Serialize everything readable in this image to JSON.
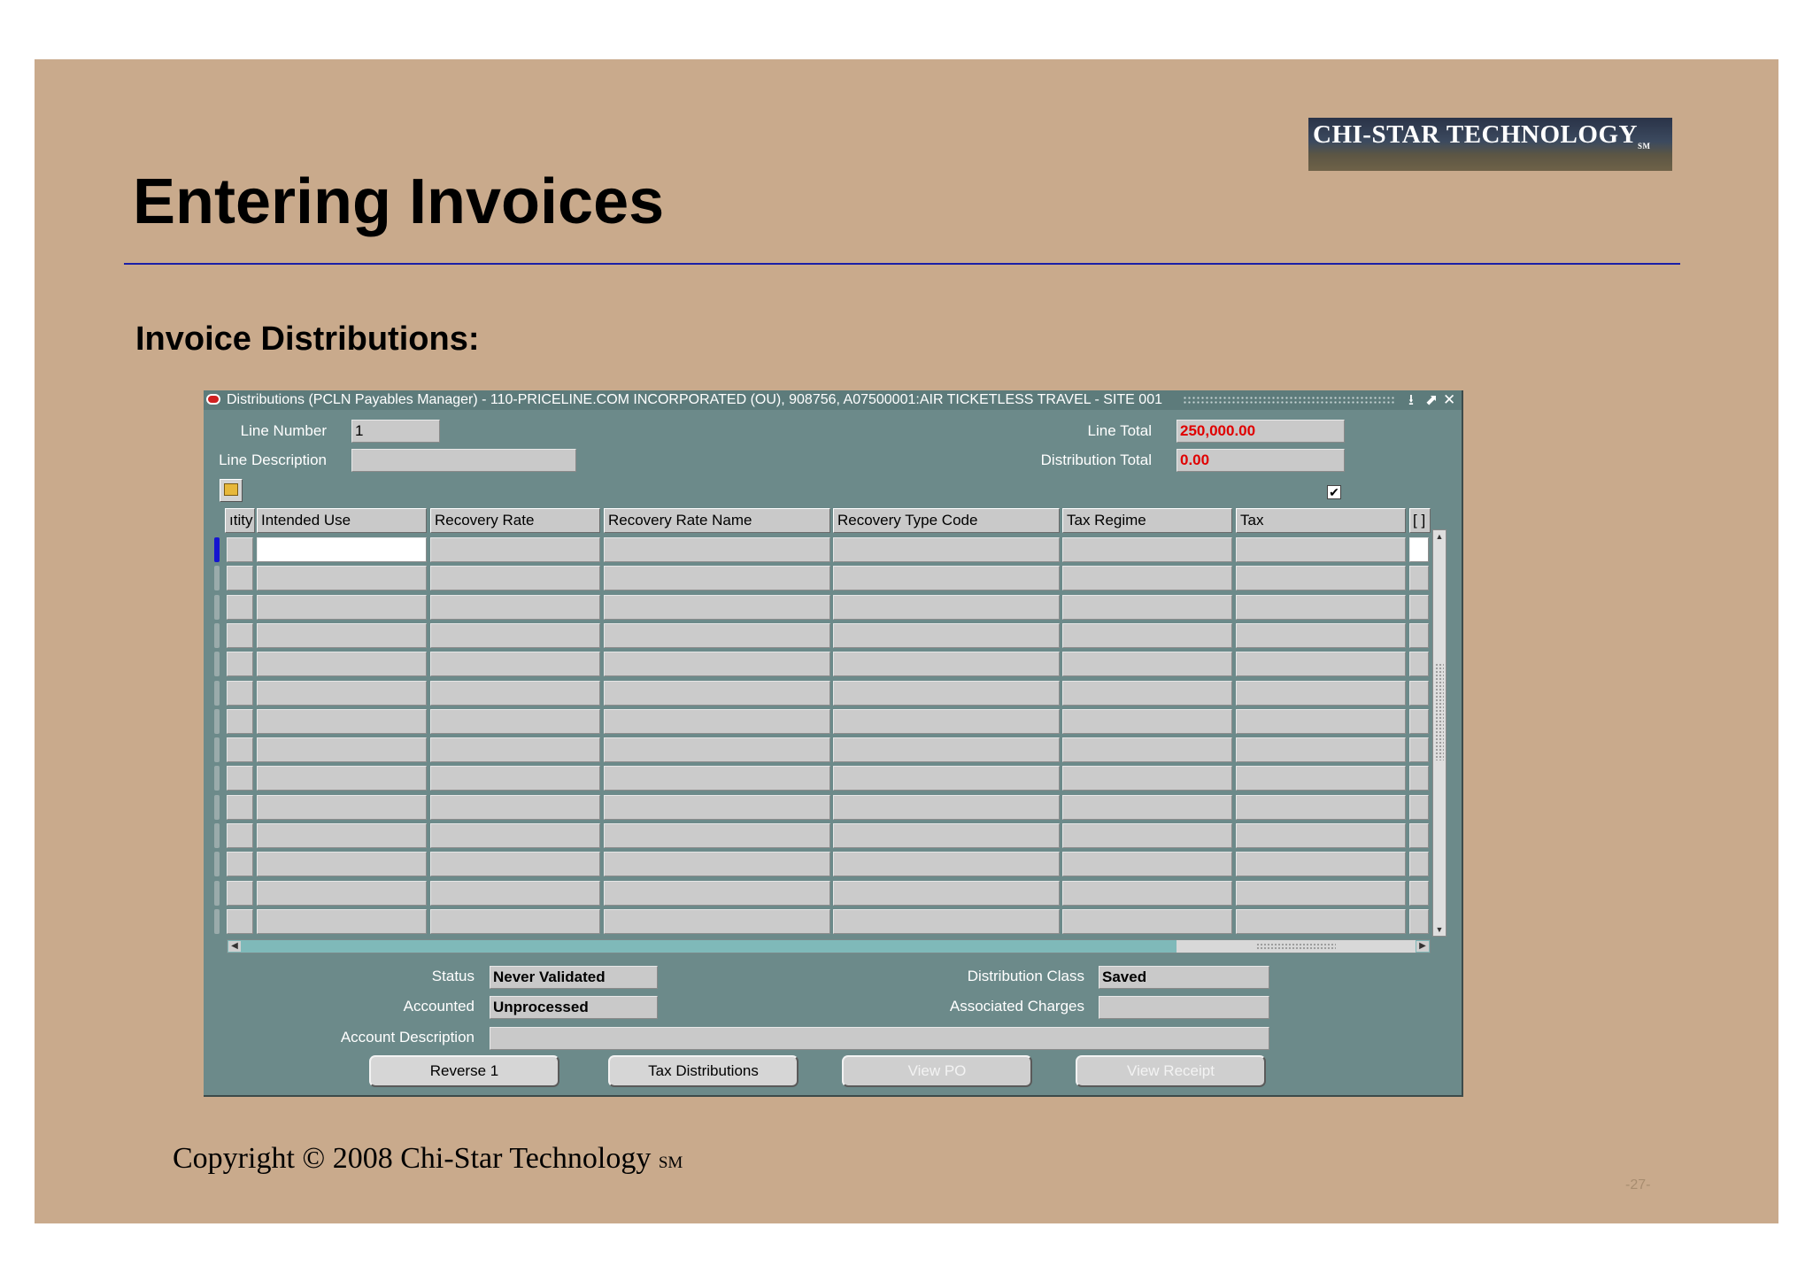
{
  "slide": {
    "title": "Entering Invoices",
    "subtitle": "Invoice Distributions:",
    "logo_text": "CHI-STAR TECHNOLOGY",
    "logo_mark": "SM",
    "copyright": "Copyright © 2008 Chi-Star Technology",
    "copyright_mark": "SM",
    "page_number": "-27-"
  },
  "window": {
    "title": "Distributions (PCLN Payables Manager) - 110-PRICELINE.COM INCORPORATED (OU), 908756, A07500001:AIR TICKETLESS TRAVEL - SITE 001",
    "controls": {
      "minimize": "⭳",
      "maximize": "⬈",
      "close": "✕"
    }
  },
  "header": {
    "line_number_label": "Line Number",
    "line_number_value": "1",
    "line_description_label": "Line Description",
    "line_description_value": "",
    "line_total_label": "Line Total",
    "line_total_value": "250,000.00",
    "distribution_total_label": "Distribution Total",
    "distribution_total_value": "0.00",
    "checkbox_checked": true
  },
  "grid": {
    "columns": [
      "ıtity",
      "Intended Use",
      "Recovery Rate",
      "Recovery Rate Name",
      "Recovery Type Code",
      "Tax Regime",
      "Tax",
      "[ ]"
    ],
    "row_count": 14,
    "active_row": 0
  },
  "footer": {
    "status_label": "Status",
    "status_value": "Never Validated",
    "accounted_label": "Accounted",
    "accounted_value": "Unprocessed",
    "account_description_label": "Account Description",
    "account_description_value": "",
    "distribution_class_label": "Distribution Class",
    "distribution_class_value": "Saved",
    "associated_charges_label": "Associated Charges",
    "associated_charges_value": ""
  },
  "buttons": {
    "reverse": "Reverse 1",
    "tax_distributions": "Tax Distributions",
    "view_po": "View PO",
    "view_receipt": "View Receipt"
  },
  "colors": {
    "slide_bg": "#c9aa8c",
    "window_bg": "#6c8a8a",
    "accent_rule": "#1a1fa8",
    "total_value": "#e00000"
  }
}
